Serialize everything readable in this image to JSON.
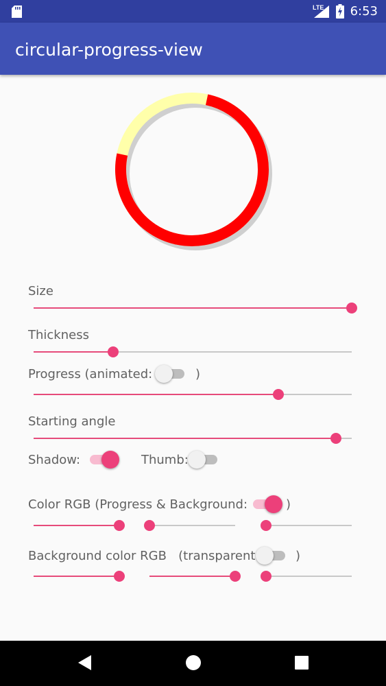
{
  "status_bar": {
    "time": "6:53",
    "network": "LTE",
    "icons": [
      "sd-card-icon",
      "signal-icon",
      "battery-charging-icon"
    ]
  },
  "app_bar": {
    "title": "circular-progress-view"
  },
  "progress_view": {
    "progress_fraction": 0.75,
    "start_angle_deg": 12,
    "progress_color": "#ff0000",
    "background_color": "#ffffaa",
    "shadow": true,
    "thumb": false
  },
  "controls": {
    "size": {
      "label": "Size",
      "value": 1.0
    },
    "thickness": {
      "label": "Thickness",
      "value": 0.25
    },
    "progress": {
      "label_prefix": "Progress (animated:",
      "label_suffix": ")",
      "animated": false,
      "value": 0.77
    },
    "starting_angle": {
      "label": "Starting angle",
      "value": 0.95
    },
    "shadow": {
      "label": "Shadow:",
      "value": true
    },
    "thumb": {
      "label": "Thumb:",
      "value": false
    },
    "color_rgb": {
      "label_prefix": "Color RGB (Progress & Background:",
      "label_suffix": ")",
      "toggle": true,
      "r": 1.0,
      "g": 0.0,
      "b": 0.0
    },
    "background_rgb": {
      "label_prefix": "Background color RGB   (transparent :",
      "label_suffix": ")",
      "transparent": false,
      "r": 1.0,
      "g": 1.0,
      "b": 0.0
    }
  },
  "theme": {
    "accent": "#ec407a",
    "primary": "#3f51b5",
    "primary_dark": "#303f9f"
  },
  "nav_bar": {
    "buttons": [
      "back-icon",
      "home-icon",
      "recents-icon"
    ]
  }
}
